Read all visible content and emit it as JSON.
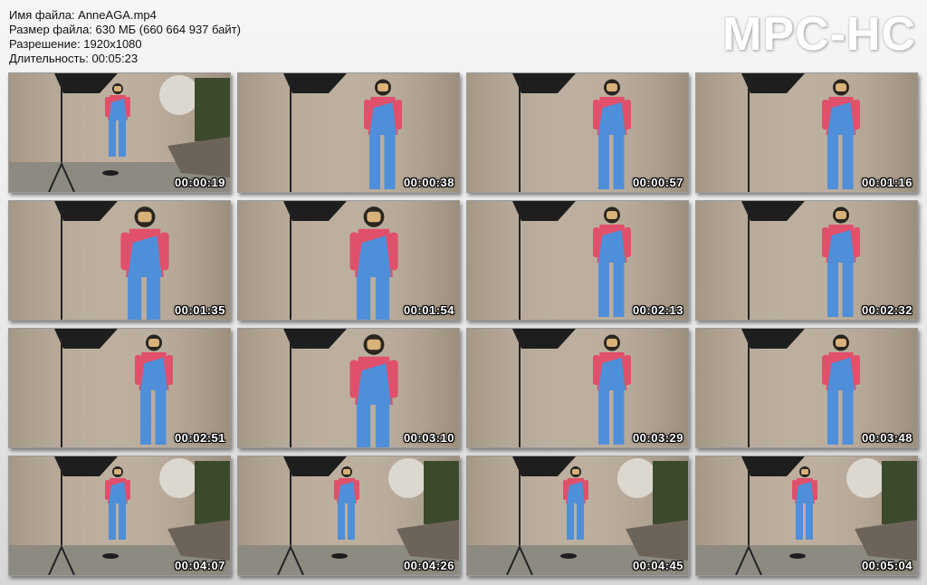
{
  "file_info": {
    "filename_line": "Имя файла: AnneAGA.mp4",
    "size_line": "Размер файла: 630 МБ (660 664 937 байт)",
    "resolution_line": "Разрешение: 1920x1080",
    "duration_line": "Длительность: 00:05:23"
  },
  "logo": "MPC-HC",
  "colors": {
    "background": "#ececec",
    "wall": "#b4a491",
    "suit_blue": "#4f8fd9",
    "suit_pink": "#e0506a",
    "timestamp_text": "#ffffff"
  },
  "thumbnails": [
    {
      "time": "00:00:19",
      "scene": "wide"
    },
    {
      "time": "00:00:38",
      "scene": "medium"
    },
    {
      "time": "00:00:57",
      "scene": "medium"
    },
    {
      "time": "00:01:16",
      "scene": "medium"
    },
    {
      "time": "00:01:35",
      "scene": "close"
    },
    {
      "time": "00:01:54",
      "scene": "close"
    },
    {
      "time": "00:02:13",
      "scene": "medium"
    },
    {
      "time": "00:02:32",
      "scene": "medium"
    },
    {
      "time": "00:02:51",
      "scene": "medium"
    },
    {
      "time": "00:03:10",
      "scene": "close"
    },
    {
      "time": "00:03:29",
      "scene": "medium"
    },
    {
      "time": "00:03:48",
      "scene": "medium"
    },
    {
      "time": "00:04:07",
      "scene": "wide"
    },
    {
      "time": "00:04:26",
      "scene": "wide"
    },
    {
      "time": "00:04:45",
      "scene": "wide"
    },
    {
      "time": "00:05:04",
      "scene": "wide"
    }
  ]
}
